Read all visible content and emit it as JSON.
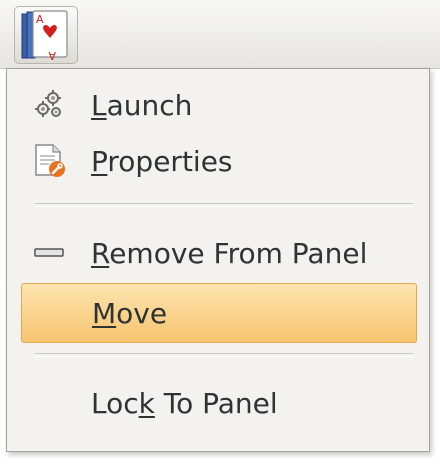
{
  "panel": {
    "launcher_icon": "solitaire-cards-icon"
  },
  "menu": {
    "items": [
      {
        "pre": "",
        "mnemonic": "L",
        "post": "aunch",
        "icon": "gears-icon"
      },
      {
        "pre": "",
        "mnemonic": "P",
        "post": "roperties",
        "icon": "properties-document-icon"
      },
      {
        "pre": "",
        "mnemonic": "R",
        "post": "emove From Panel",
        "icon": "remove-bar-icon"
      },
      {
        "pre": "",
        "mnemonic": "M",
        "post": "ove",
        "icon": ""
      },
      {
        "pre": "Loc",
        "mnemonic": "k",
        "post": " To Panel",
        "icon": ""
      }
    ],
    "highlight_color": "#f8cf85"
  }
}
